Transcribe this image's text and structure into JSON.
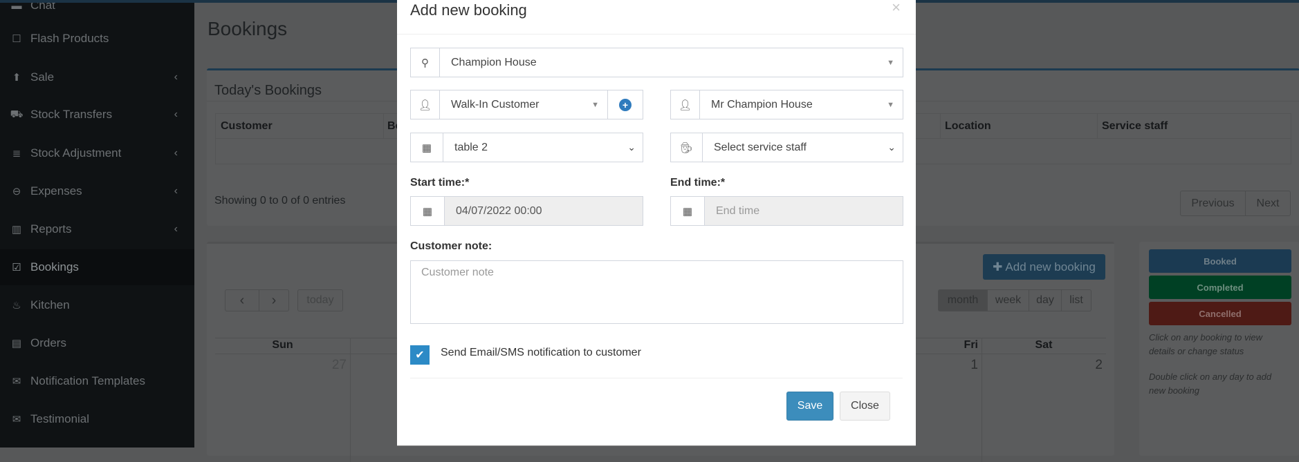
{
  "sidebar": {
    "items": [
      {
        "label": "Chat",
        "icon": "chat-icon"
      },
      {
        "label": "Flash Products",
        "icon": "square-icon"
      },
      {
        "label": "Sale",
        "icon": "arrow-circle-up-icon",
        "has_submenu": true
      },
      {
        "label": "Stock Transfers",
        "icon": "truck-icon",
        "has_submenu": true
      },
      {
        "label": "Stock Adjustment",
        "icon": "database-icon",
        "has_submenu": true
      },
      {
        "label": "Expenses",
        "icon": "minus-circle-icon",
        "has_submenu": true
      },
      {
        "label": "Reports",
        "icon": "bar-chart-icon",
        "has_submenu": true
      },
      {
        "label": "Bookings",
        "icon": "calendar-check-icon",
        "active": true
      },
      {
        "label": "Kitchen",
        "icon": "fire-icon"
      },
      {
        "label": "Orders",
        "icon": "list-alt-icon"
      },
      {
        "label": "Notification Templates",
        "icon": "envelope-icon"
      },
      {
        "label": "Testimonial",
        "icon": "envelope-icon"
      }
    ]
  },
  "page": {
    "title": "Bookings",
    "todays": {
      "title": "Today's Bookings",
      "columns": [
        "Customer",
        "Bo",
        "Location",
        "Service staff"
      ],
      "info": "Showing 0 to 0 of 0 entries",
      "prev": "Previous",
      "next": "Next"
    },
    "calendar": {
      "add_label": "Add new booking",
      "today": "today",
      "views": [
        "month",
        "week",
        "day",
        "list"
      ],
      "active_view": "month",
      "days": [
        "Sun",
        "Fri",
        "Sat"
      ],
      "dates": [
        "27",
        "1",
        "2"
      ]
    },
    "legend": {
      "booked": "Booked",
      "completed": "Completed",
      "cancelled": "Cancelled",
      "hint1": "Click on any booking to view details or change status",
      "hint2": "Double click on any day to add new booking",
      "colors": {
        "booked": "#1b3a52",
        "completed": "#004024",
        "cancelled": "#4e1a15"
      }
    }
  },
  "modal": {
    "title": "Add new booking",
    "close_icon": "×",
    "location": "Champion House",
    "customer": "Walk-In Customer",
    "correspondent": "Mr Champion House",
    "table": "table 2",
    "service_staff": "Select service staff",
    "start_label": "Start time:*",
    "start_value": "04/07/2022 00:00",
    "end_label": "End time:*",
    "end_placeholder": "End time",
    "note_label": "Customer note:",
    "note_placeholder": "Customer note",
    "notify_label": "Send Email/SMS notification to customer",
    "notify_checked": true,
    "save": "Save",
    "close": "Close",
    "accent": "#3c8dbc"
  }
}
